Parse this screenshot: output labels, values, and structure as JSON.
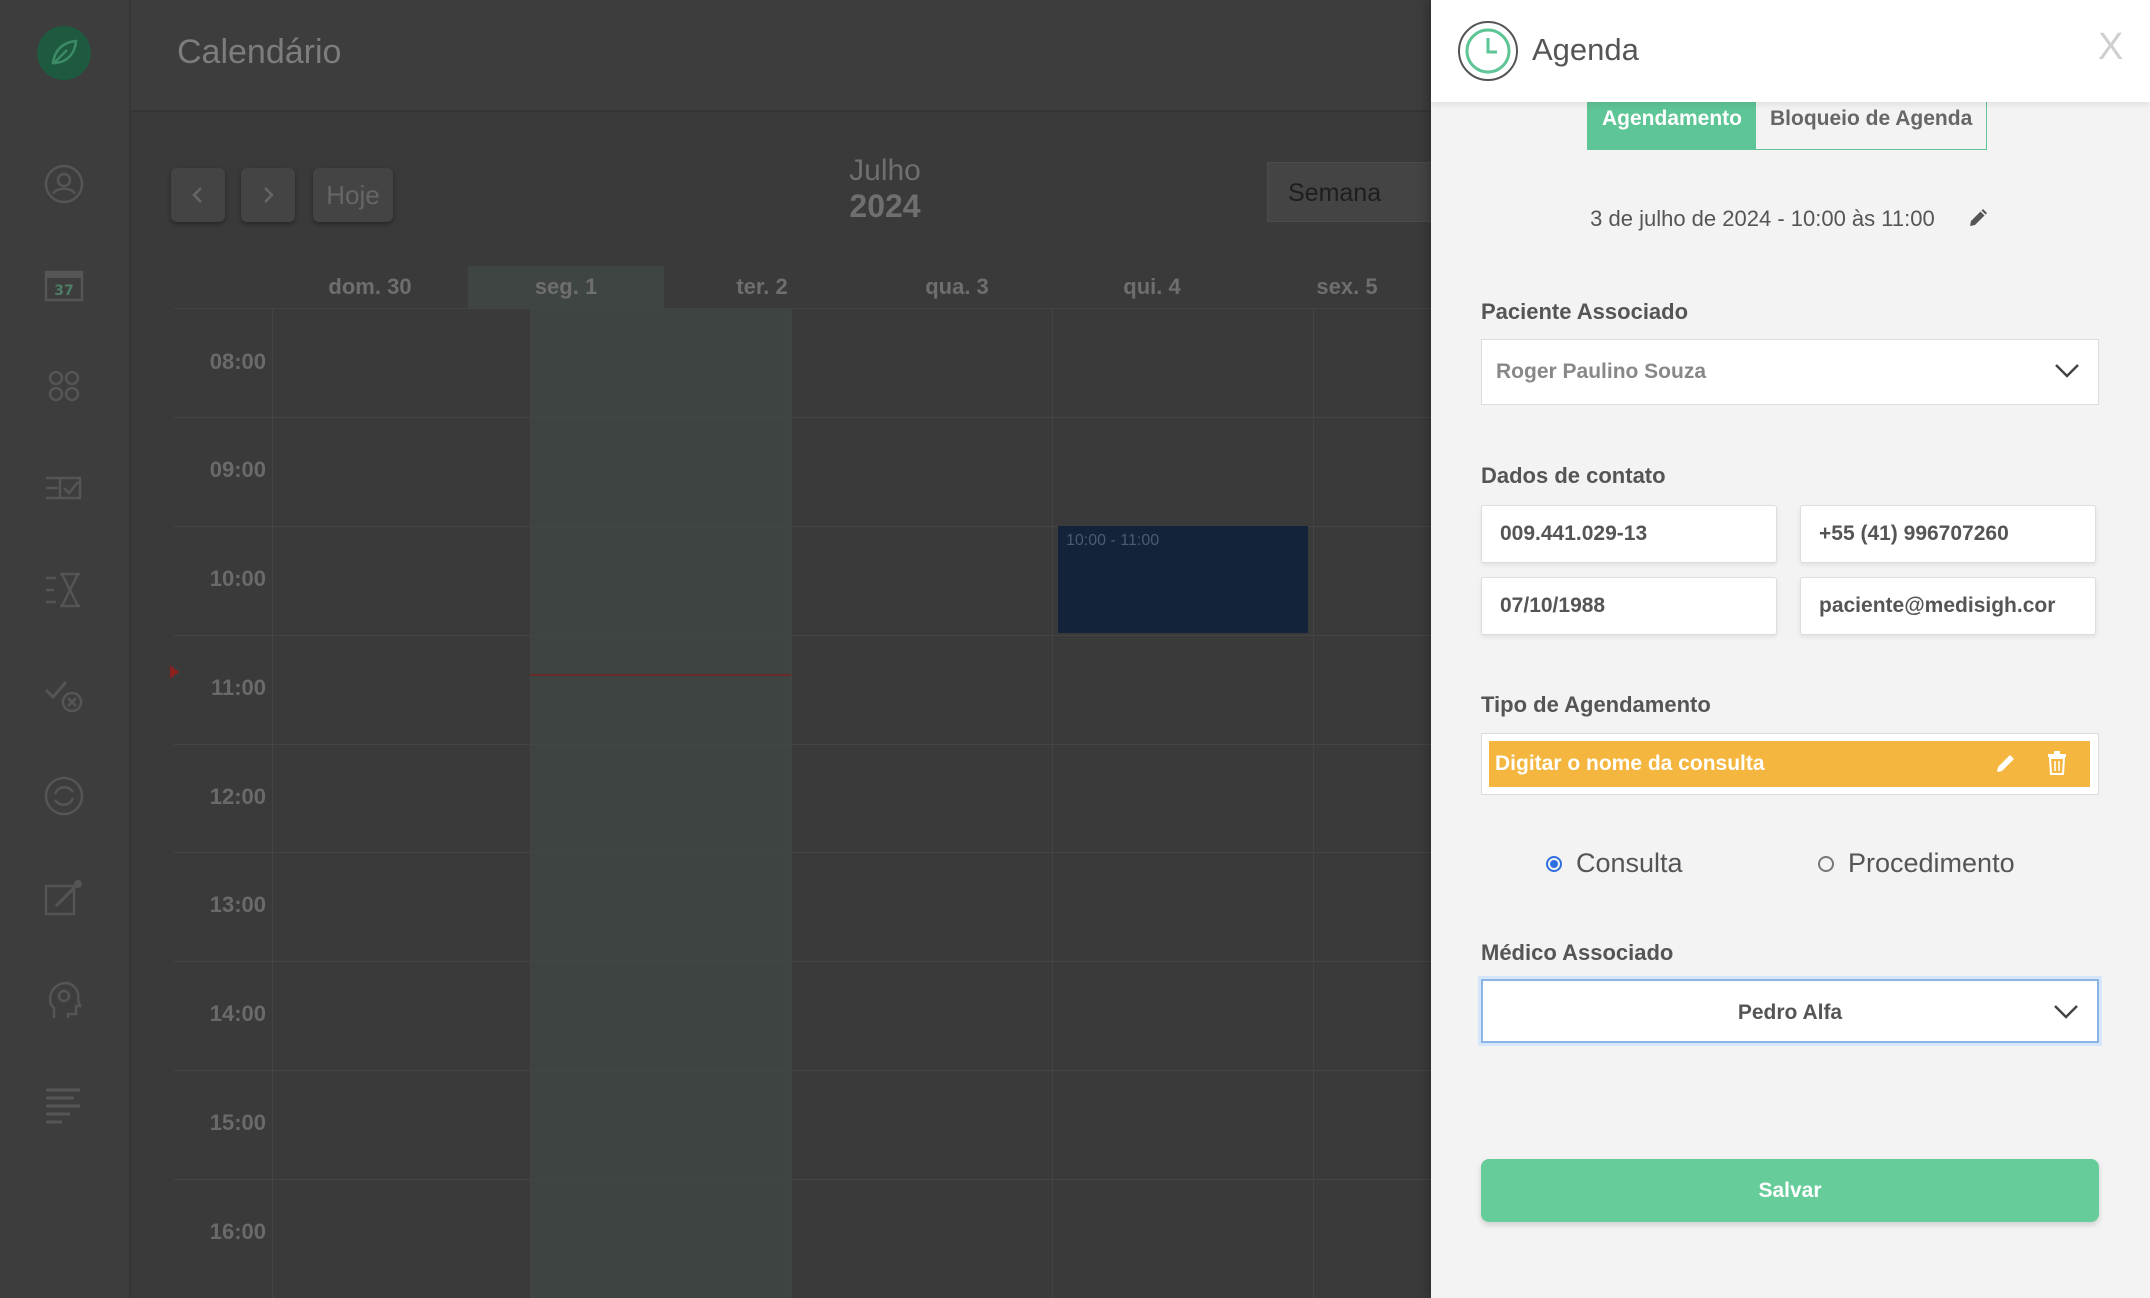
{
  "header": {
    "title": "Calendário"
  },
  "calendar": {
    "today_label": "Hoje",
    "month": "Julho",
    "year": "2024",
    "view": "Semana",
    "days": [
      "dom. 30",
      "seg. 1",
      "ter. 2",
      "qua. 3",
      "qui. 4",
      "sex. 5"
    ],
    "hours": [
      "08:00",
      "09:00",
      "10:00",
      "11:00",
      "12:00",
      "13:00",
      "14:00",
      "15:00",
      "16:00"
    ],
    "event": {
      "time": "10:00 - 11:00"
    }
  },
  "panel": {
    "title": "Agenda",
    "close_label": "X",
    "tabs": {
      "appointment": "Agendamento",
      "block": "Bloqueio de Agenda"
    },
    "datetime": "3 de julho de 2024 - 10:00 às 11:00",
    "patient_label": "Paciente Associado",
    "patient_value": "Roger Paulino Souza",
    "contact_label": "Dados de contato",
    "contact": {
      "cpf": "009.441.029-13",
      "phone": "+55 (41) 996707260",
      "birthdate": "07/10/1988",
      "email": "paciente@medisigh.cor"
    },
    "type_label": "Tipo de Agendamento",
    "type_value": "Digitar o nome da consulta",
    "radio_consulta": "Consulta",
    "radio_procedimento": "Procedimento",
    "doctor_label": "Médico Associado",
    "doctor_value": "Pedro Alfa",
    "save_label": "Salvar"
  },
  "colors": {
    "accent": "#5ec596",
    "save": "#66cc99",
    "type_chip": "#f4b63f",
    "event": "#13233a"
  }
}
